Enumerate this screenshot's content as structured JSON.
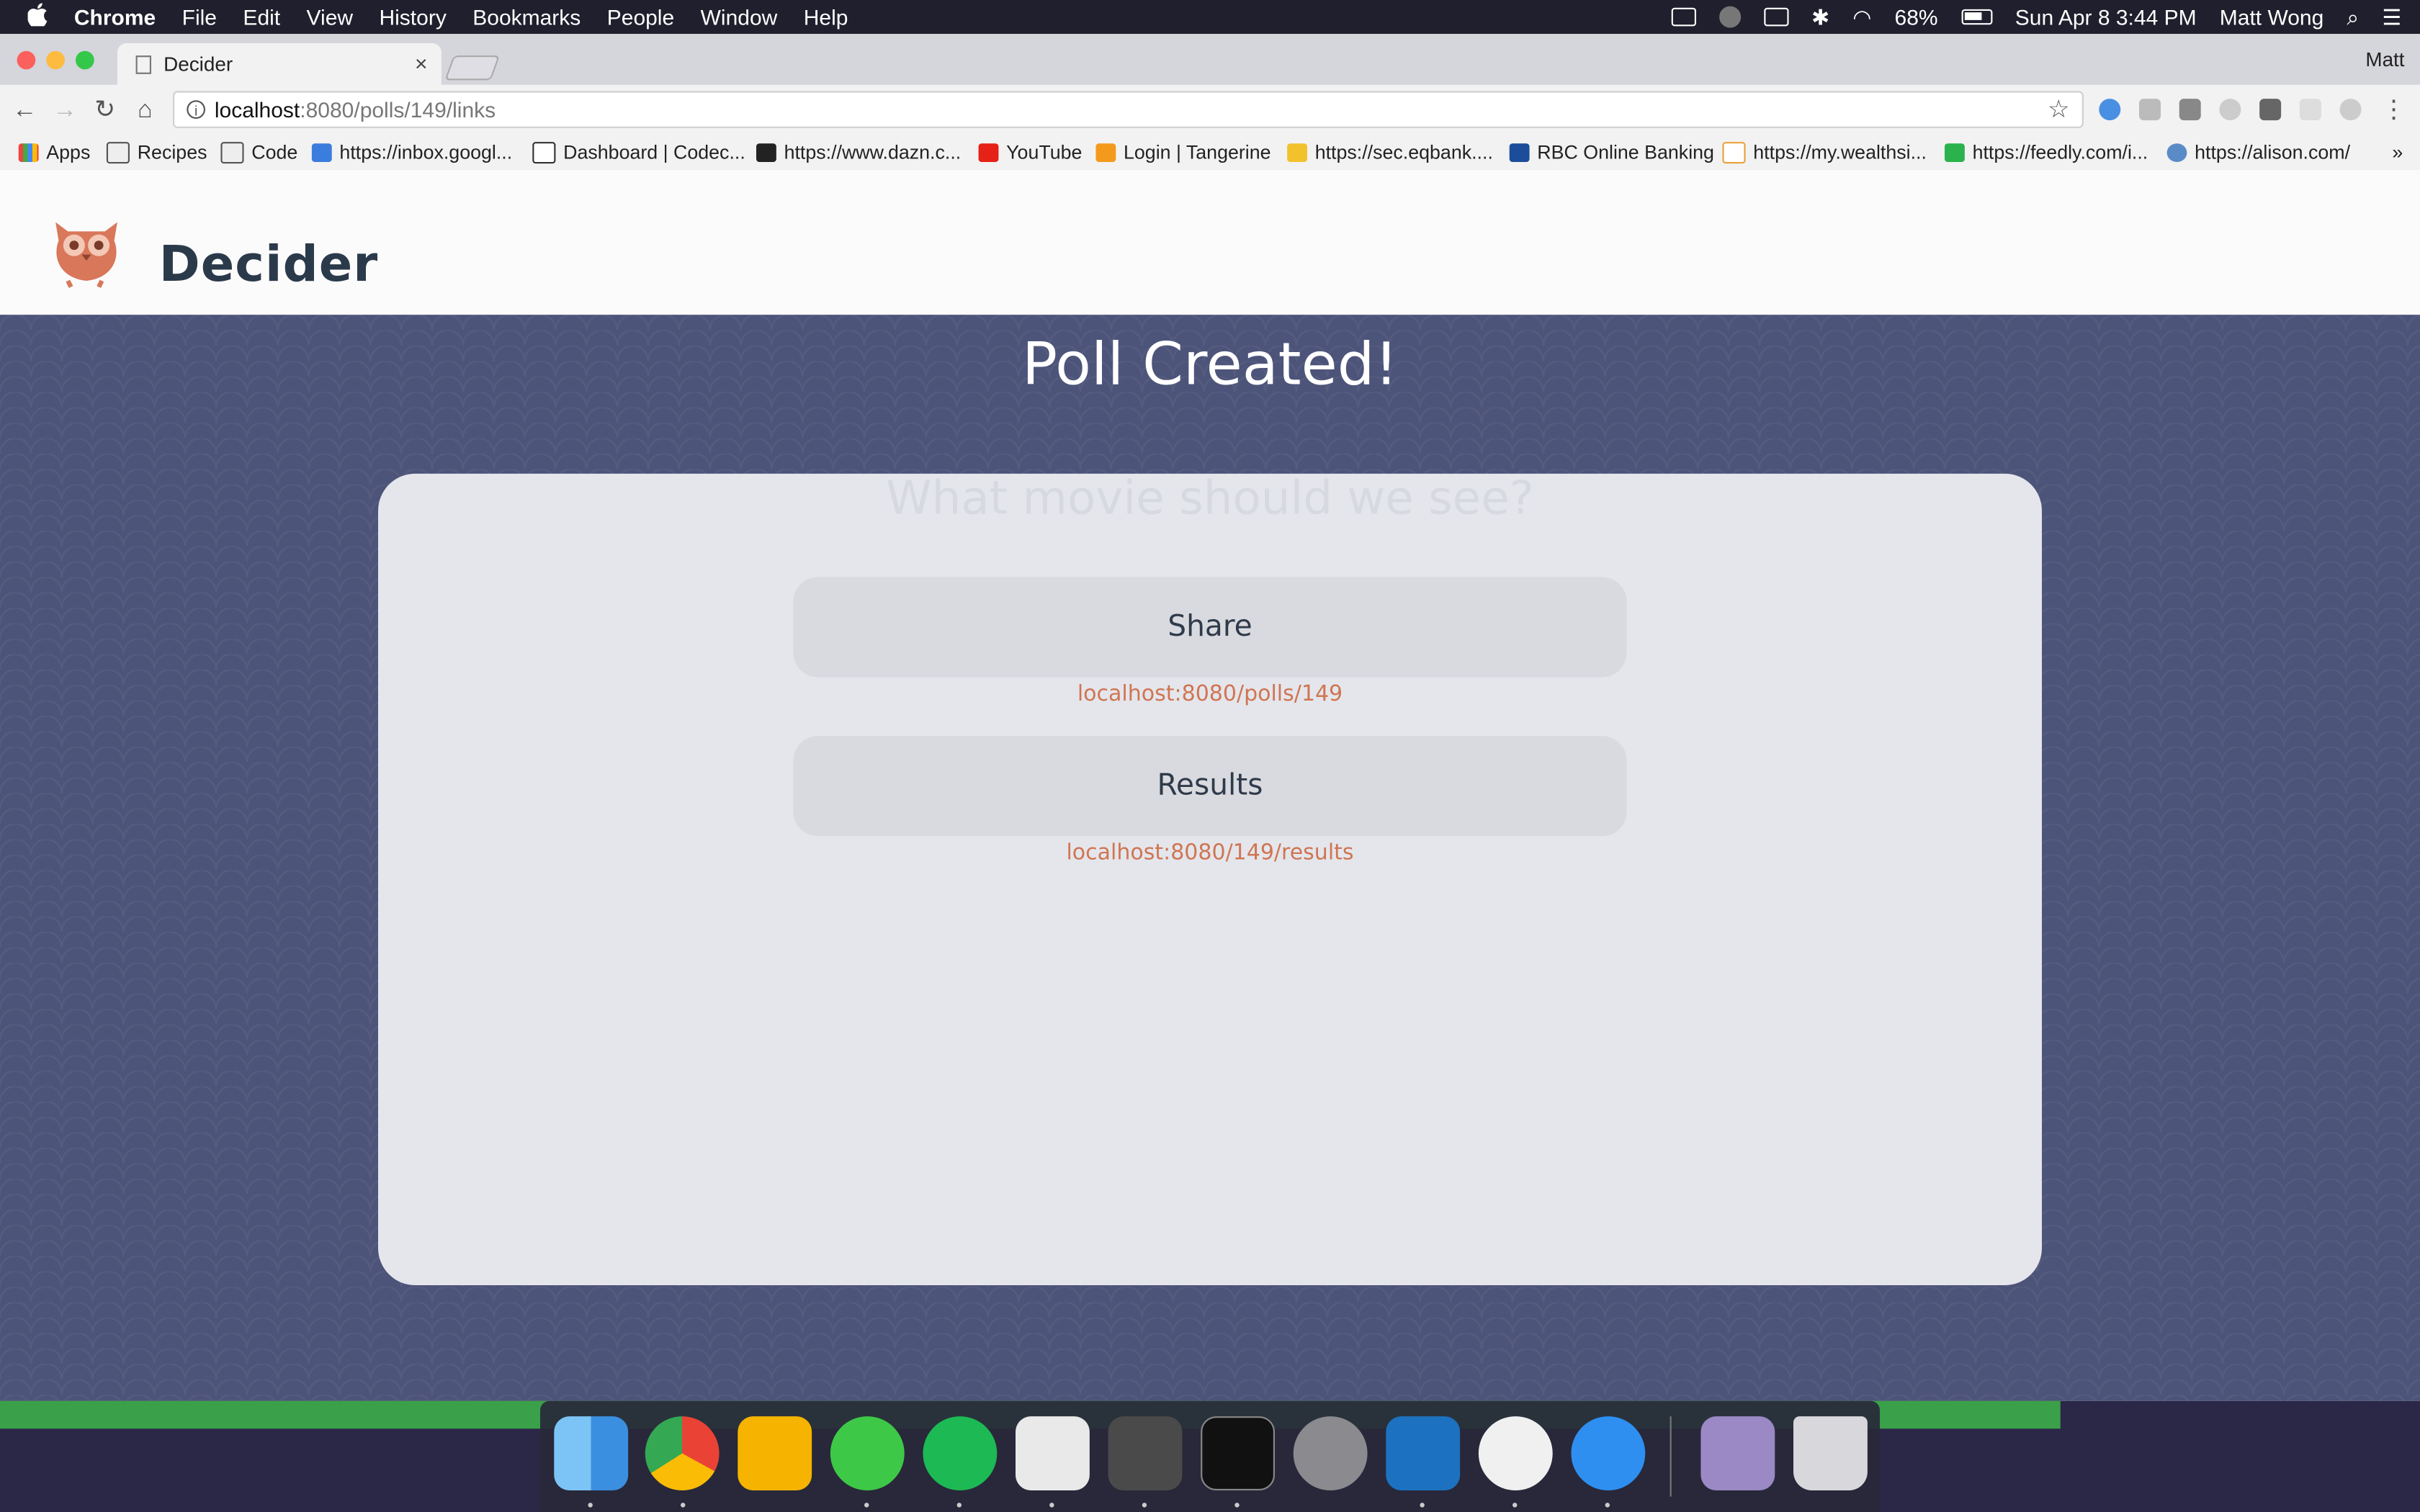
{
  "menubar": {
    "apple": "",
    "items": [
      "Chrome",
      "File",
      "Edit",
      "View",
      "History",
      "Bookmarks",
      "People",
      "Window",
      "Help"
    ],
    "battery": "68%",
    "datetime": "Sun Apr 8  3:44 PM",
    "user": "Matt Wong"
  },
  "browser": {
    "tab_title": "Decider",
    "tab_close": "×",
    "profile": "Matt",
    "url_host": "localhost",
    "url_path": ":8080/polls/149/links",
    "star": "☆",
    "back": "←",
    "forward": "→",
    "reload": "↻",
    "home": "⌂",
    "menu": "⋮",
    "bookmarks": [
      "Apps",
      "Recipes",
      "Code",
      "https://inbox.googl...",
      "Dashboard | Codec...",
      "https://www.dazn.c...",
      "YouTube",
      "Login | Tangerine",
      "https://sec.eqbank....",
      "RBC Online Banking",
      "https://my.wealthsi...",
      "https://feedly.com/i...",
      "https://alison.com/"
    ],
    "bookmarks_more": "»"
  },
  "site": {
    "brand": "Decider",
    "hero_title": "Poll Created!",
    "ghost_question": "What movie should we see?",
    "share_label": "Share",
    "share_link": "localhost:8080/polls/149",
    "results_label": "Results",
    "results_link": "localhost:8080/149/results"
  },
  "colors": {
    "accent": "#d07552",
    "hero_bg": "#4d5479",
    "card_bg": "#e4e6ec",
    "brand_text": "#2b3a4a"
  },
  "dock": [
    "finder-icon",
    "chrome-icon",
    "keep-icon",
    "whatsapp-icon",
    "spotify-icon",
    "slack-icon",
    "sublime-icon",
    "terminal-icon",
    "system-preferences-icon",
    "trello-icon",
    "itunes-icon",
    "safari-icon",
    "downloads-icon",
    "trash-icon"
  ]
}
